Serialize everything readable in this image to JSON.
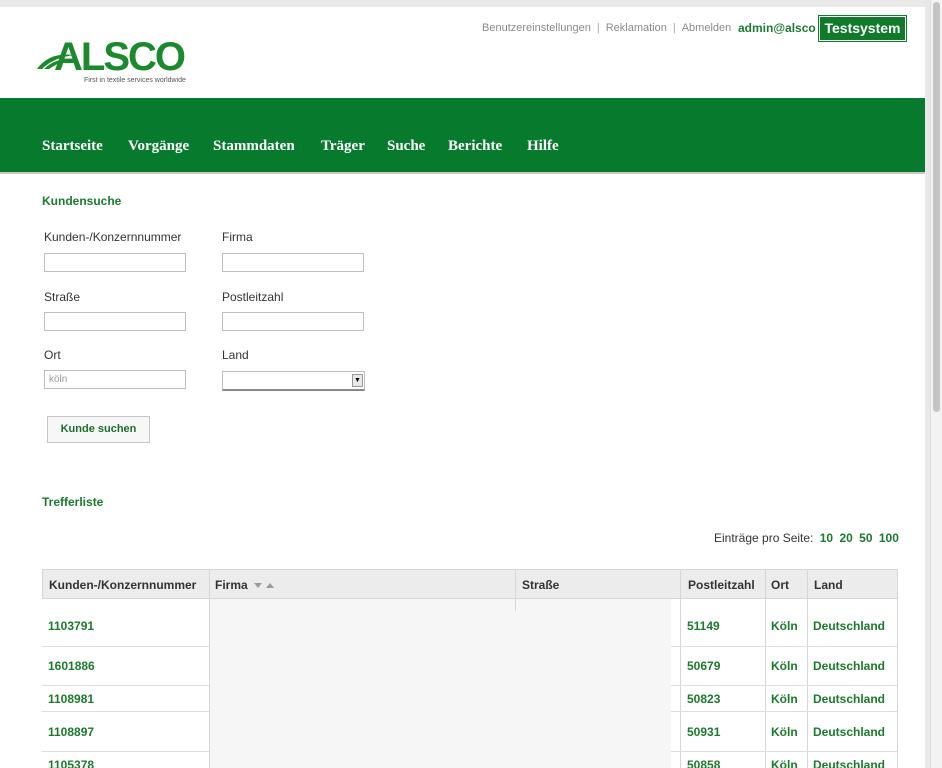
{
  "header": {
    "logo_text": "ALSCO",
    "logo_tagline": "First in textile services worldwide",
    "links": [
      "Benutzereinstellungen",
      "Reklamation",
      "Abmelden"
    ],
    "user": "admin@alsco",
    "environment_badge": "Testsystem"
  },
  "nav": {
    "items": [
      "Startseite",
      "Vorgänge",
      "Stammdaten",
      "Träger",
      "Suche",
      "Berichte",
      "Hilfe"
    ]
  },
  "search_form": {
    "title": "Kundensuche",
    "fields": {
      "customer_number": {
        "label": "Kunden-/Konzernnummer",
        "value": ""
      },
      "firma": {
        "label": "Firma",
        "value": ""
      },
      "strasse": {
        "label": "Straße",
        "value": ""
      },
      "plz": {
        "label": "Postleitzahl",
        "value": ""
      },
      "ort": {
        "label": "Ort",
        "value": "köln"
      },
      "land": {
        "label": "Land",
        "value": ""
      }
    },
    "submit_label": "Kunde suchen"
  },
  "results": {
    "title": "Trefferliste",
    "per_page_label": "Einträge pro Seite:",
    "per_page_options": [
      "10",
      "20",
      "50",
      "100"
    ],
    "columns": [
      "Kunden-/Konzernnummer",
      "Firma",
      "Straße",
      "Postleitzahl",
      "Ort",
      "Land"
    ],
    "rows": [
      {
        "nummer": "1103791",
        "firma": "",
        "strasse": "",
        "plz": "51149",
        "ort": "Köln",
        "land": "Deutschland"
      },
      {
        "nummer": "1601886",
        "firma": "",
        "strasse": "",
        "plz": "50679",
        "ort": "Köln",
        "land": "Deutschland"
      },
      {
        "nummer": "1108981",
        "firma": "",
        "strasse": "",
        "plz": "50823",
        "ort": "Köln",
        "land": "Deutschland"
      },
      {
        "nummer": "1108897",
        "firma": "",
        "strasse": "",
        "plz": "50931",
        "ort": "Köln",
        "land": "Deutschland"
      },
      {
        "nummer": "1105378",
        "firma": "",
        "strasse": "",
        "plz": "50858",
        "ort": "Köln",
        "land": "Deutschland"
      }
    ]
  },
  "colors": {
    "brand_green": "#087a2e",
    "link_green": "#1b7a2c"
  }
}
